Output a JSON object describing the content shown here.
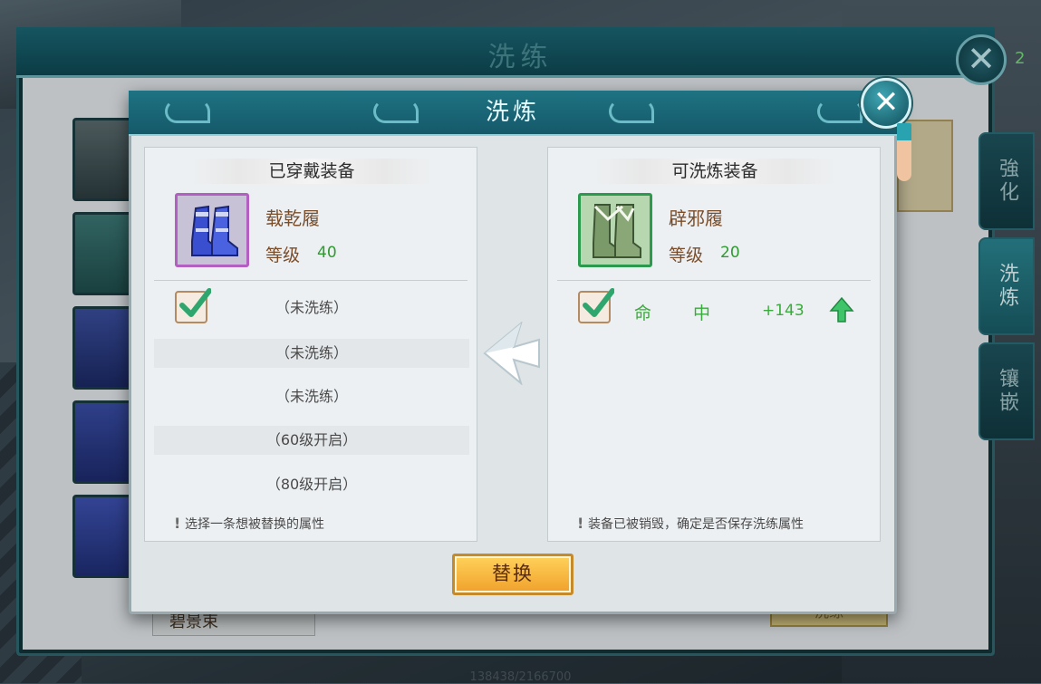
{
  "outer_window": {
    "title": "洗练",
    "badge": "2",
    "item_name": "碧景束",
    "bottom_text": "138438/2166700",
    "ghost_button_label": "洗练",
    "tabs": [
      {
        "label": "強化",
        "active": false
      },
      {
        "label": "洗炼",
        "active": true
      },
      {
        "label": "镶嵌",
        "active": false
      }
    ]
  },
  "modal": {
    "title": "洗炼",
    "close_icon": "close-icon",
    "left_panel": {
      "title": "已穿戴装备",
      "equip_name": "载乾履",
      "level_label": "等级",
      "level_value": "40",
      "rows": [
        {
          "text": "（未洗练）",
          "checked": true
        },
        {
          "text": "（未洗练）",
          "checked": false
        },
        {
          "text": "（未洗练）",
          "checked": false
        },
        {
          "text": "（60级开启）",
          "checked": false
        },
        {
          "text": "（80级开启）",
          "checked": false
        }
      ],
      "hint": "选择一条想被替换的属性"
    },
    "right_panel": {
      "title": "可洗炼装备",
      "equip_name": "辟邪履",
      "level_label": "等级",
      "level_value": "20",
      "attr_name_1": "命",
      "attr_name_2": "中",
      "attr_value": "+143",
      "hint": "装备已被销毁，确定是否保存洗练属性"
    },
    "replace_button": "替换"
  },
  "colors": {
    "header_teal": "#1e7382",
    "attr_green": "#3aaa3c",
    "name_brown": "#7a4d2b",
    "button_gold": "#f0a12c"
  }
}
